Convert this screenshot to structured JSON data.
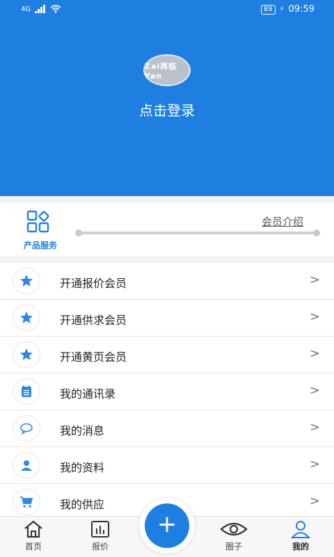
{
  "status_bar": {
    "network": "4G",
    "battery": "89",
    "time": "09:59"
  },
  "header": {
    "logo_text": "Zai再临Yan",
    "login_text": "点击登录"
  },
  "product_service": {
    "label": "产品服务",
    "member_intro": "会员介绍"
  },
  "menu": {
    "items": [
      {
        "label": "开通报价会员",
        "icon": "star-icon"
      },
      {
        "label": "开通供求会员",
        "icon": "star-icon"
      },
      {
        "label": "开通黄页会员",
        "icon": "star-icon"
      },
      {
        "label": "我的通讯录",
        "icon": "contacts-icon"
      },
      {
        "label": "我的消息",
        "icon": "message-icon"
      },
      {
        "label": "我的资料",
        "icon": "profile-icon"
      },
      {
        "label": "我的供应",
        "icon": "cart-icon"
      }
    ]
  },
  "bottom_nav": {
    "home": "首页",
    "quote": "报价",
    "add": "+",
    "circle": "圈子",
    "mine": "我的"
  },
  "colors": {
    "accent": "#1e7fe0"
  }
}
